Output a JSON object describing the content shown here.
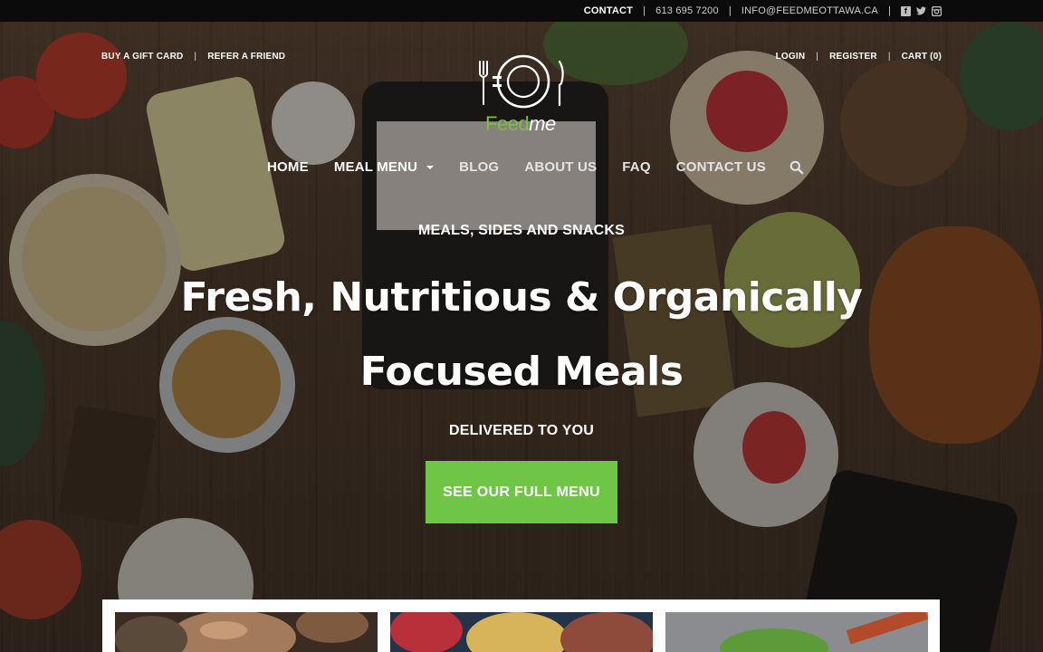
{
  "topbar": {
    "contact_label": "CONTACT",
    "phone": "613 695 7200",
    "email": "INFO@FEEDMEOTTAWA.CA",
    "social": [
      {
        "name": "facebook-icon",
        "glyph": "f"
      },
      {
        "name": "twitter-icon",
        "glyph": "t"
      },
      {
        "name": "instagram-icon",
        "glyph": "◘"
      }
    ]
  },
  "header": {
    "left_links": [
      "BUY A GIFT CARD",
      "REFER A FRIEND"
    ],
    "right_links": [
      "LOGIN",
      "REGISTER",
      "CART (0)"
    ],
    "logo": {
      "feed": "Feed",
      "me": "me"
    }
  },
  "nav": {
    "home": "HOME",
    "meal_menu": "MEAL MENU",
    "blog": "BLOG",
    "about": "ABOUT US",
    "faq": "FAQ",
    "contact": "CONTACT US"
  },
  "hero": {
    "eyebrow": "MEALS, SIDES AND SNACKS",
    "headline": "Fresh, Nutritious & Organically Focused Meals",
    "subline": "DELIVERED TO YOU",
    "cta": "SEE OUR FULL MENU"
  },
  "colors": {
    "brand_green": "#6fc545",
    "logo_green": "#7ac143",
    "topbar_bg": "#0b0b0b"
  }
}
